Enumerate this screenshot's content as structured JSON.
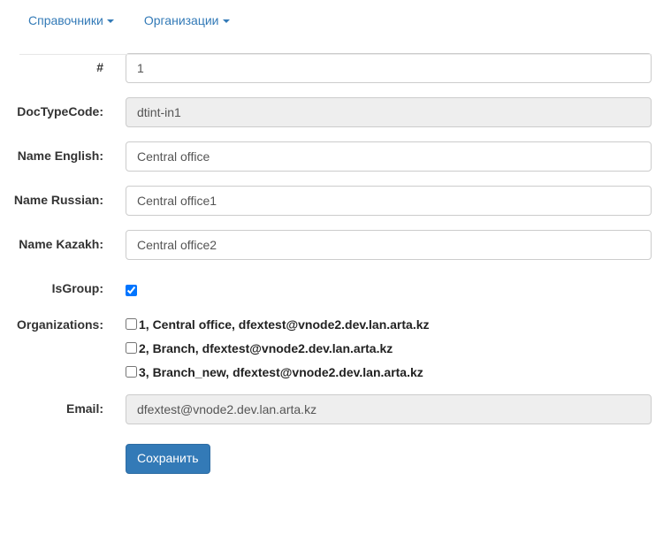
{
  "navbar": {
    "items": [
      {
        "label": "Справочники",
        "icon": "caret-down-icon"
      },
      {
        "label": "Организации",
        "icon": "caret-down-icon"
      }
    ]
  },
  "form": {
    "fields": [
      {
        "label": "#",
        "value": "1",
        "disabled": false
      },
      {
        "label": "DocTypeCode:",
        "value": "dtint-in1",
        "disabled": true
      },
      {
        "label": "Name English:",
        "value": "Central office",
        "disabled": false
      },
      {
        "label": "Name Russian:",
        "value": "Central office1",
        "disabled": false
      },
      {
        "label": "Name Kazakh:",
        "value": "Central office2",
        "disabled": false
      }
    ],
    "is_group": {
      "label": "IsGroup:",
      "checked": true
    },
    "organizations": {
      "label": "Organizations:",
      "items": [
        {
          "label": "1, Central office, dfextest@vnode2.dev.lan.arta.kz",
          "checked": false
        },
        {
          "label": "2, Branch, dfextest@vnode2.dev.lan.arta.kz",
          "checked": false
        },
        {
          "label": "3, Branch_new, dfextest@vnode2.dev.lan.arta.kz",
          "checked": false
        }
      ]
    },
    "email": {
      "label": "Email:",
      "value": "dfextest@vnode2.dev.lan.arta.kz",
      "disabled": true
    },
    "submit": {
      "label": "Сохранить"
    }
  },
  "colors": {
    "link": "#337ab7",
    "primary": "#337ab7",
    "primary_border": "#2e6da4",
    "input_border": "#cccccc",
    "disabled_bg": "#eeeeee",
    "divider": "#e7e7e7",
    "text": "#333333",
    "value_text": "#555555"
  }
}
